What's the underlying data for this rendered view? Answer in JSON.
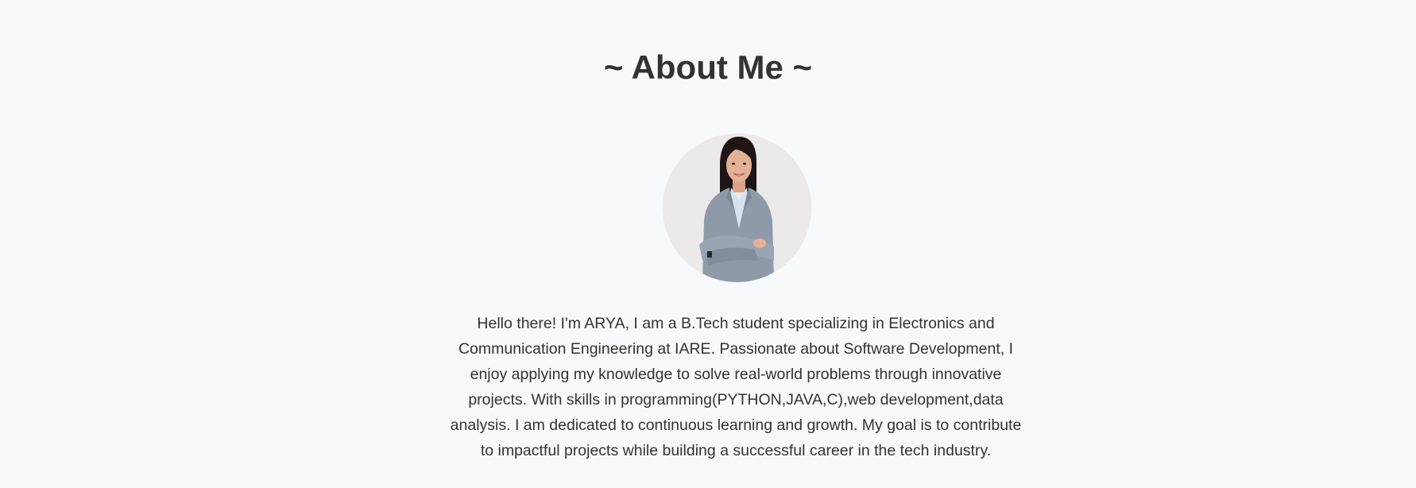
{
  "about": {
    "title": "~ About Me ~",
    "bio": "Hello there! I'm ARYA, I am a B.Tech student specializing in Electronics and Communication Engineering at IARE. Passionate about Software Development, I enjoy applying my knowledge to solve real-world problems through innovative projects. With skills in programming(PYTHON,JAVA,C),web development,data analysis. I am dedicated to continuous learning and growth. My goal is to contribute to impactful projects while building a successful career in the tech industry."
  },
  "colors": {
    "page_background": "#f8f9fa",
    "text": "#333333",
    "photo_background": "#ece9ea",
    "blazer": "#8f9aa8",
    "hair": "#1e1614"
  },
  "images": {
    "profile_photo": "portrait of a smiling woman in a grey blazer with arms crossed"
  }
}
